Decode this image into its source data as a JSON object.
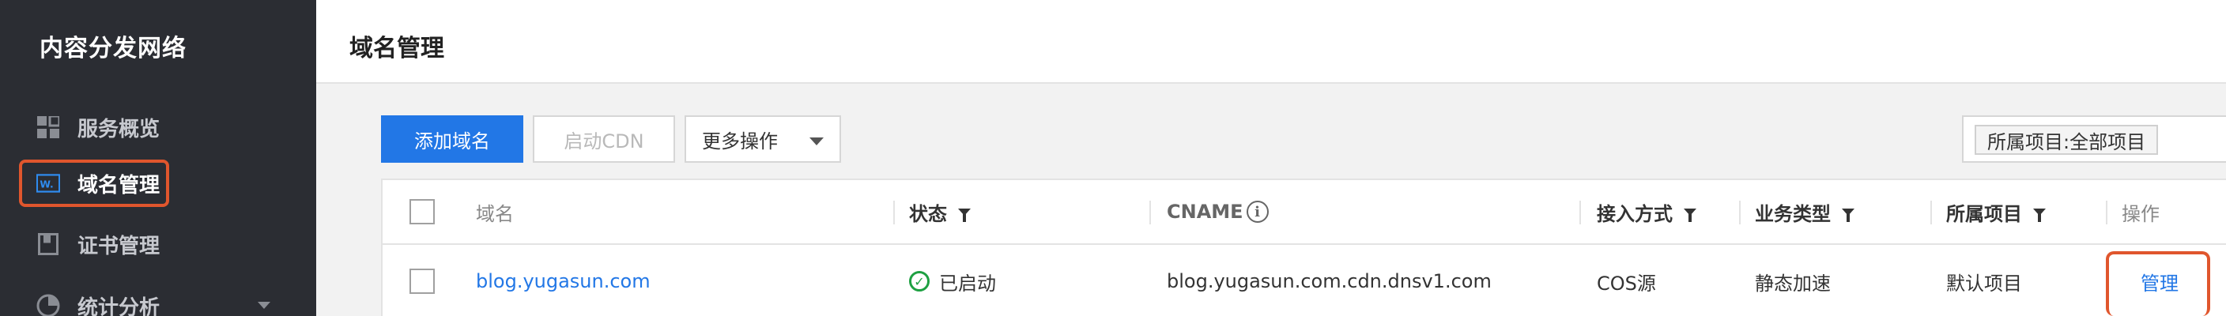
{
  "sidebar": {
    "title": "内容分发网络",
    "items": [
      {
        "label": "服务概览",
        "icon": "grid-icon"
      },
      {
        "label": "域名管理",
        "icon": "domain-www-icon"
      },
      {
        "label": "证书管理",
        "icon": "certificate-icon"
      },
      {
        "label": "统计分析",
        "icon": "pie-chart-icon"
      }
    ]
  },
  "header": {
    "title": "域名管理"
  },
  "toolbar": {
    "add_domain": "添加域名",
    "start_cdn": "启动CDN",
    "more_actions": "更多操作",
    "project_filter": "所属项目:全部项目"
  },
  "table": {
    "headers": {
      "domain": "域名",
      "status": "状态",
      "cname": "CNAME",
      "access": "接入方式",
      "business": "业务类型",
      "project": "所属项目",
      "ops": "操作"
    },
    "rows": [
      {
        "domain": "blog.yugasun.com",
        "status": "已启动",
        "cname": "blog.yugasun.com.cdn.dnsv1.com",
        "access": "COS源",
        "business": "静态加速",
        "project": "默认项目",
        "op": "管理"
      }
    ]
  },
  "colors": {
    "primary": "#2277e6",
    "sidebar_bg": "#2b2d33",
    "highlight": "#e0562d",
    "status_green": "#1ea042"
  }
}
